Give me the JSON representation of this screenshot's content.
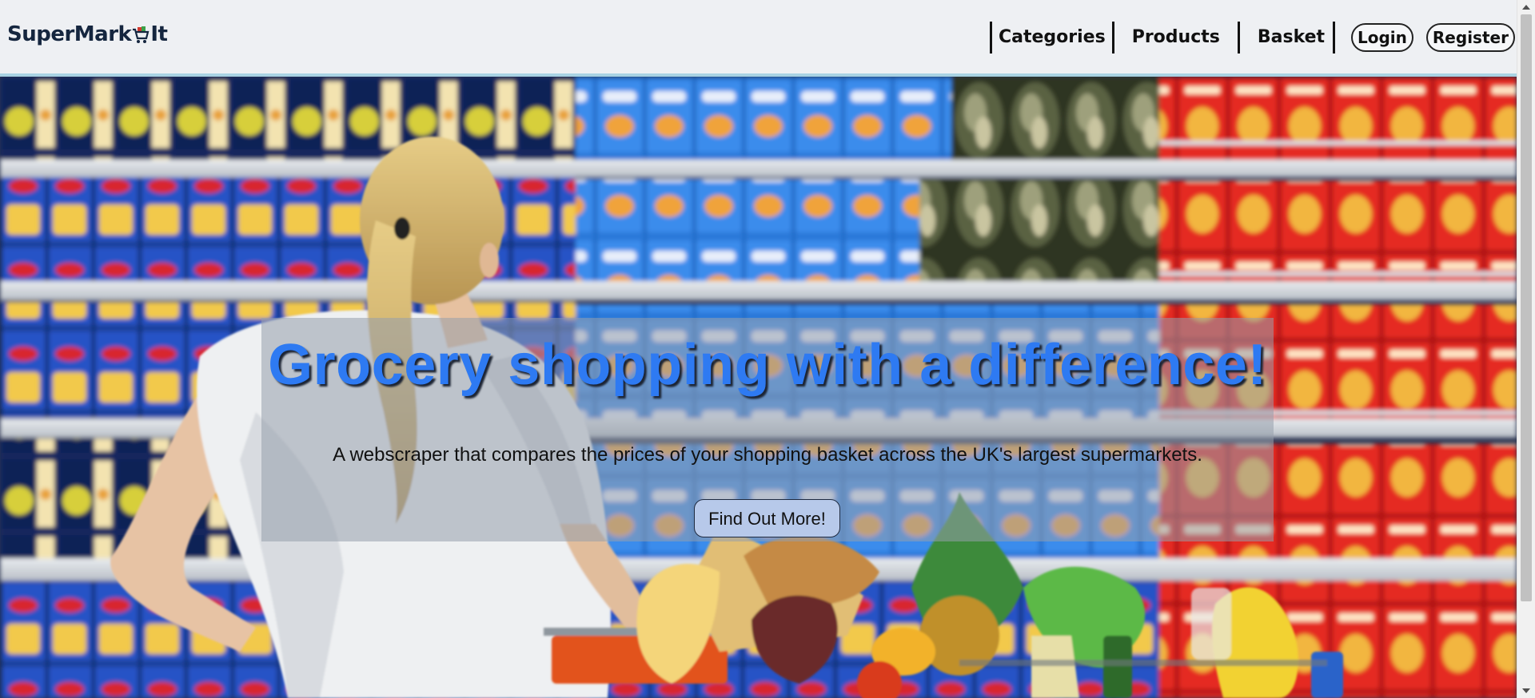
{
  "header": {
    "logo_text_before": "SuperMark",
    "logo_text_after": "It",
    "logo_icon": "shopping-cart-icon",
    "nav": {
      "categories": "Categories",
      "products": "Products",
      "basket": "Basket"
    },
    "login": "Login",
    "register": "Register"
  },
  "hero": {
    "title": "Grocery shopping with a difference!",
    "subtitle": "A webscraper that compares the prices of your shopping basket across the UK's largest supermarkets.",
    "cta": "Find Out More!",
    "background_image": "supermarket-shopper-photo"
  },
  "colors": {
    "header_bg": "#eef0f3",
    "header_border": "#a9d3e3",
    "title": "#2e7af2",
    "cta_bg": "#b7c9ea"
  }
}
